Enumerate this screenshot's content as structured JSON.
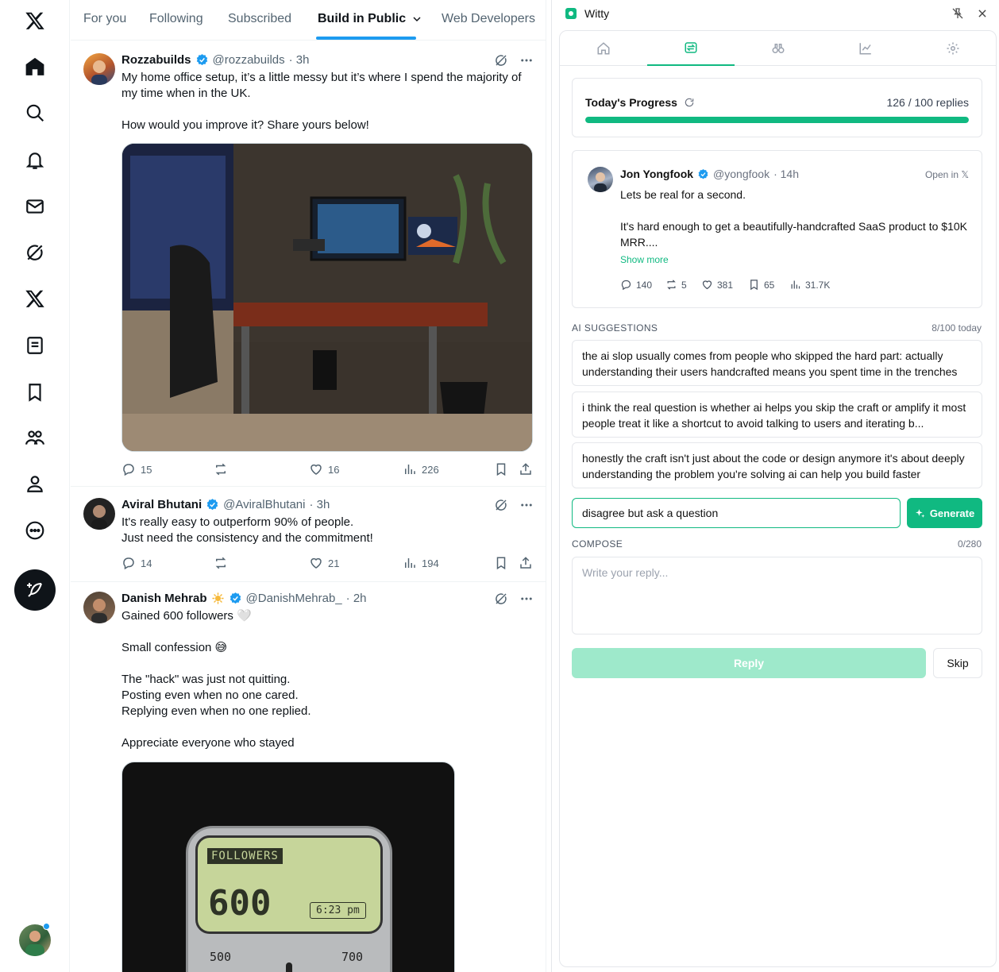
{
  "colors": {
    "x_blue": "#1d9bf0",
    "accent": "#10b981",
    "text": "#0f1419",
    "muted": "#536471"
  },
  "left_nav": {
    "icons": [
      "x-logo-icon",
      "home-icon",
      "search-icon",
      "bell-icon",
      "mail-icon",
      "grok-icon",
      "x-premium-icon",
      "lists-icon",
      "bookmark-icon",
      "communities-icon",
      "profile-icon",
      "more-icon"
    ],
    "compose_icon": "feather-plus-icon"
  },
  "feed": {
    "tabs": [
      "For you",
      "Following",
      "Subscribed",
      "Build in Public",
      "Web Developers"
    ],
    "active_tab": "Build in Public",
    "posts": [
      {
        "name": "Rozzabuilds",
        "handle": "@rozzabuilds",
        "time": "· 3h",
        "text": "My home office setup, it’s a little messy but it’s where I spend the majority of my time when in the UK.\n\nHow would you improve it? Share yours below!",
        "replies": "15",
        "reposts": "",
        "likes": "16",
        "views": "226"
      },
      {
        "name": "Aviral Bhutani",
        "handle": "@AviralBhutani",
        "time": "· 3h",
        "text": "It's really easy to outperform 90% of people.\nJust need the consistency and the commitment!",
        "replies": "14",
        "reposts": "",
        "likes": "21",
        "views": "194"
      },
      {
        "name": "Danish Mehrab",
        "handle": "@DanishMehrab_",
        "time": "· 2h",
        "text": "Gained 600 followers 🤍\n\nSmall confession 😅\n\nThe \"hack\" was just not quitting.\nPosting even when no one cared.\nReplying even when no one replied.\n\nAppreciate everyone who stayed",
        "media": {
          "label": "FOLLOWERS",
          "count": "600",
          "clock": "6:23 pm",
          "scale_left": "500",
          "scale_right": "700"
        }
      }
    ]
  },
  "extension": {
    "title": "Witty",
    "tabs": [
      "home-icon",
      "swap-icon",
      "binoculars-icon",
      "chart-icon",
      "settings-icon"
    ],
    "active_tab_index": 1,
    "progress": {
      "label": "Today's Progress",
      "done": 126,
      "goal": 100,
      "count_text": "126 / 100 replies",
      "fraction": 1.0
    },
    "tweet": {
      "name": "Jon Yongfook",
      "handle": "@yongfook",
      "time": "· 14h",
      "open_label": "Open in 𝕏",
      "text": "Lets be real for a second.\n\nIt's hard enough to get a beautifully-handcrafted SaaS product to $10K MRR....",
      "show_more": "Show more",
      "replies": "140",
      "reposts": "5",
      "likes": "381",
      "bookmarks": "65",
      "views": "31.7K"
    },
    "suggestions_label": "AI SUGGESTIONS",
    "suggestions_count": "8/100 today",
    "suggestions": [
      "the ai slop usually comes from people who skipped the hard part: actually understanding their users handcrafted means you spent time in the trenches",
      "i think the real question is whether ai helps you skip the craft or amplify it most people treat it like a shortcut to avoid talking to users and iterating b...",
      "honestly the craft isn't just about the code or design anymore it's about deeply understanding the problem you're solving ai can help you build faster"
    ],
    "prompt_value": "disagree but ask a question",
    "generate_label": "Generate",
    "compose_label": "COMPOSE",
    "compose_count": "0/280",
    "compose_placeholder": "Write your reply...",
    "reply_label": "Reply",
    "skip_label": "Skip"
  }
}
